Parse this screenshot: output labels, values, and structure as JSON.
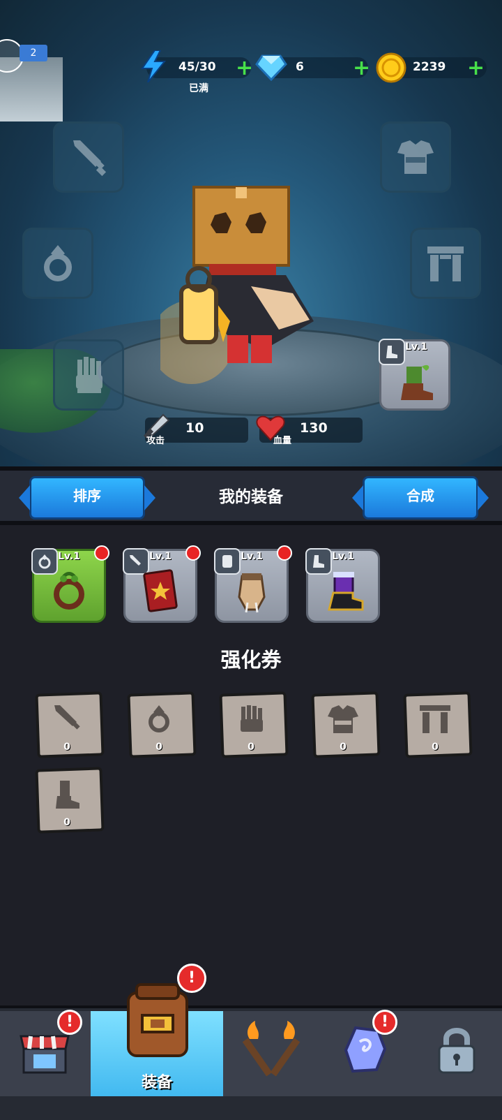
{
  "resources": {
    "energy": {
      "value": "45/30",
      "status": "已满"
    },
    "gems": {
      "value": "6"
    },
    "coins": {
      "value": "2239"
    }
  },
  "player": {
    "level": "2"
  },
  "stats": {
    "attack": {
      "value": "10",
      "label": "攻击"
    },
    "hp": {
      "value": "130",
      "label": "血量"
    }
  },
  "equipped_boot": {
    "level": "Lv.1"
  },
  "toolbar": {
    "sort_label": "排序",
    "title": "我的装备",
    "craft_label": "合成"
  },
  "inventory": [
    {
      "slot": "ring",
      "level": "Lv.1",
      "rarity": "green"
    },
    {
      "slot": "weapon",
      "level": "Lv.1",
      "rarity": "grey"
    },
    {
      "slot": "glove",
      "level": "Lv.1",
      "rarity": "grey"
    },
    {
      "slot": "boot",
      "level": "Lv.1",
      "rarity": "grey"
    }
  ],
  "vouchers": {
    "title": "强化券",
    "items": [
      {
        "slot": "weapon",
        "count": "0"
      },
      {
        "slot": "ring",
        "count": "0"
      },
      {
        "slot": "glove",
        "count": "0"
      },
      {
        "slot": "armor",
        "count": "0"
      },
      {
        "slot": "gate",
        "count": "0"
      },
      {
        "slot": "boot",
        "count": "0"
      }
    ]
  },
  "nav": {
    "shop": {
      "alert": "!"
    },
    "equipment": {
      "label": "装备",
      "alert": "!"
    },
    "battle": {},
    "rune": {
      "alert": "!"
    },
    "locked": {}
  },
  "colors": {
    "accent_blue": "#2a9df0",
    "alert_red": "#e52b2b",
    "plus_green": "#48e04a"
  }
}
